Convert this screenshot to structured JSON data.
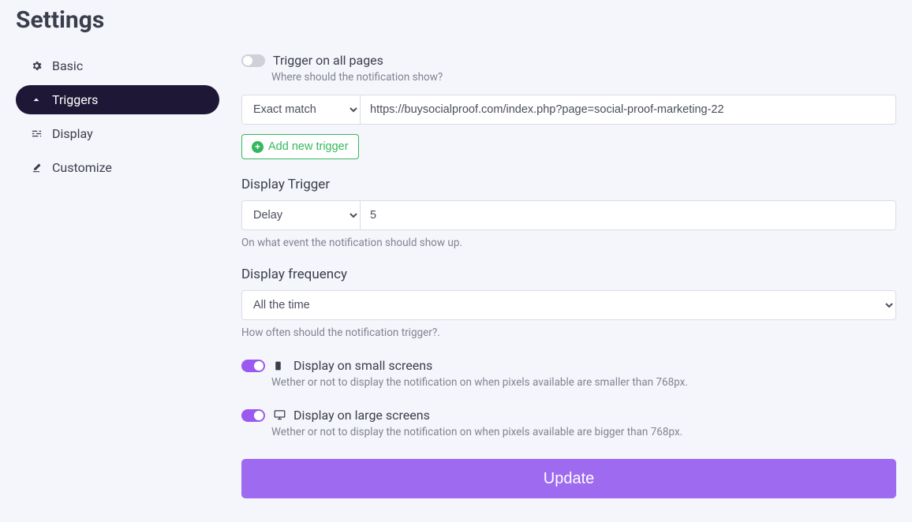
{
  "page_title": "Settings",
  "sidebar": {
    "items": [
      {
        "label": "Basic"
      },
      {
        "label": "Triggers"
      },
      {
        "label": "Display"
      },
      {
        "label": "Customize"
      }
    ]
  },
  "trigger_all": {
    "label": "Trigger on all pages",
    "hint": "Where should the notification show?"
  },
  "trigger_rule": {
    "match_option": "Exact match",
    "url": "https://buysocialproof.com/index.php?page=social-proof-marketing-22"
  },
  "add_trigger_label": "Add new trigger",
  "display_trigger": {
    "label": "Display Trigger",
    "mode_option": "Delay",
    "value": "5",
    "hint": "On what event the notification should show up."
  },
  "display_frequency": {
    "label": "Display frequency",
    "option": "All the time",
    "hint": "How often should the notification trigger?."
  },
  "small_screens": {
    "label": "Display on small screens",
    "hint": "Wether or not to display the notification on when pixels available are smaller than 768px."
  },
  "large_screens": {
    "label": "Display on large screens",
    "hint": "Wether or not to display the notification on when pixels available are bigger than 768px."
  },
  "update_label": "Update"
}
